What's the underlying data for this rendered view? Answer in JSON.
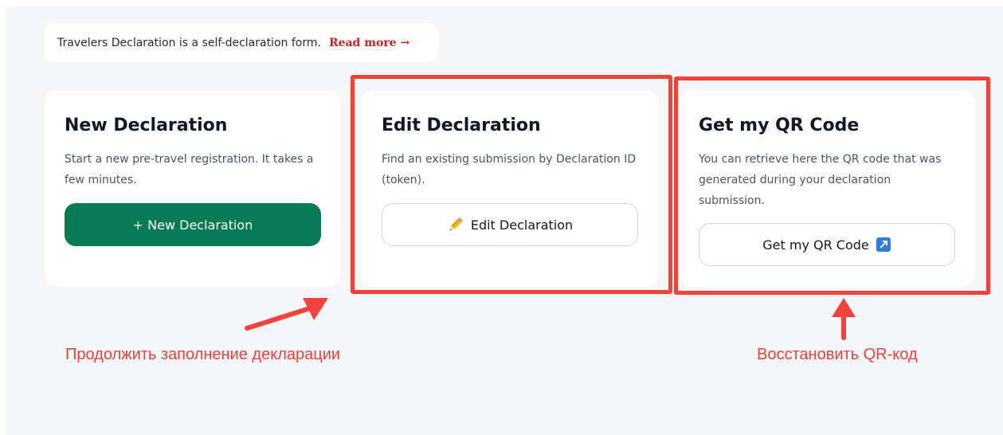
{
  "banner": {
    "text": "Travelers Declaration is a self-declaration form.",
    "link_label": "Read more →"
  },
  "cards": [
    {
      "title": "New Declaration",
      "description": "Start a new pre-travel registration. It takes a few minutes.",
      "button_label": "+ New Declaration"
    },
    {
      "title": "Edit Declaration",
      "description": "Find an existing submission by Declaration ID (token).",
      "button_label": "Edit Declaration",
      "button_icon": "pencil-icon"
    },
    {
      "title": "Get my QR Code",
      "description": "You can retrieve here the QR code that was generated during your declaration submission.",
      "button_label": "Get my QR Code",
      "button_icon": "external-link-icon"
    }
  ],
  "annotations": {
    "left_caption": "Продолжить заполнение декларации",
    "right_caption": "Восстановить QR-код",
    "color": "#f2433a"
  },
  "colors": {
    "primary_button": "#087a55",
    "link": "#cc1f1f",
    "background": "#f6f7f9"
  }
}
